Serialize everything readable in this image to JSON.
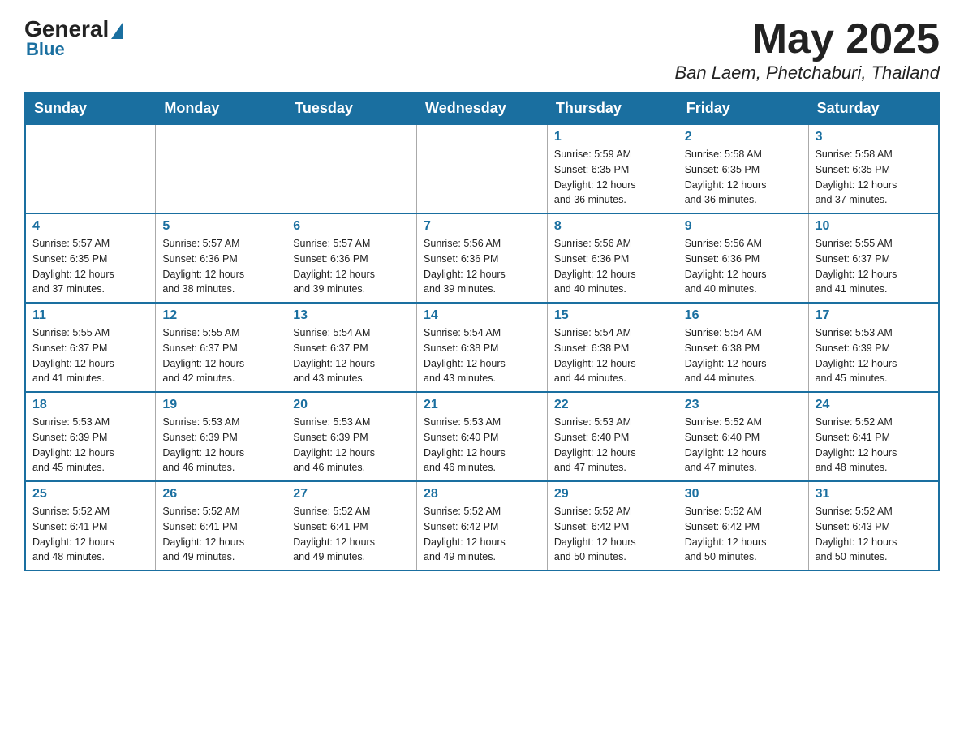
{
  "header": {
    "logo_general": "General",
    "logo_blue": "Blue",
    "month_title": "May 2025",
    "location": "Ban Laem, Phetchaburi, Thailand"
  },
  "days_of_week": [
    "Sunday",
    "Monday",
    "Tuesday",
    "Wednesday",
    "Thursday",
    "Friday",
    "Saturday"
  ],
  "weeks": [
    [
      {
        "day": "",
        "info": ""
      },
      {
        "day": "",
        "info": ""
      },
      {
        "day": "",
        "info": ""
      },
      {
        "day": "",
        "info": ""
      },
      {
        "day": "1",
        "info": "Sunrise: 5:59 AM\nSunset: 6:35 PM\nDaylight: 12 hours\nand 36 minutes."
      },
      {
        "day": "2",
        "info": "Sunrise: 5:58 AM\nSunset: 6:35 PM\nDaylight: 12 hours\nand 36 minutes."
      },
      {
        "day": "3",
        "info": "Sunrise: 5:58 AM\nSunset: 6:35 PM\nDaylight: 12 hours\nand 37 minutes."
      }
    ],
    [
      {
        "day": "4",
        "info": "Sunrise: 5:57 AM\nSunset: 6:35 PM\nDaylight: 12 hours\nand 37 minutes."
      },
      {
        "day": "5",
        "info": "Sunrise: 5:57 AM\nSunset: 6:36 PM\nDaylight: 12 hours\nand 38 minutes."
      },
      {
        "day": "6",
        "info": "Sunrise: 5:57 AM\nSunset: 6:36 PM\nDaylight: 12 hours\nand 39 minutes."
      },
      {
        "day": "7",
        "info": "Sunrise: 5:56 AM\nSunset: 6:36 PM\nDaylight: 12 hours\nand 39 minutes."
      },
      {
        "day": "8",
        "info": "Sunrise: 5:56 AM\nSunset: 6:36 PM\nDaylight: 12 hours\nand 40 minutes."
      },
      {
        "day": "9",
        "info": "Sunrise: 5:56 AM\nSunset: 6:36 PM\nDaylight: 12 hours\nand 40 minutes."
      },
      {
        "day": "10",
        "info": "Sunrise: 5:55 AM\nSunset: 6:37 PM\nDaylight: 12 hours\nand 41 minutes."
      }
    ],
    [
      {
        "day": "11",
        "info": "Sunrise: 5:55 AM\nSunset: 6:37 PM\nDaylight: 12 hours\nand 41 minutes."
      },
      {
        "day": "12",
        "info": "Sunrise: 5:55 AM\nSunset: 6:37 PM\nDaylight: 12 hours\nand 42 minutes."
      },
      {
        "day": "13",
        "info": "Sunrise: 5:54 AM\nSunset: 6:37 PM\nDaylight: 12 hours\nand 43 minutes."
      },
      {
        "day": "14",
        "info": "Sunrise: 5:54 AM\nSunset: 6:38 PM\nDaylight: 12 hours\nand 43 minutes."
      },
      {
        "day": "15",
        "info": "Sunrise: 5:54 AM\nSunset: 6:38 PM\nDaylight: 12 hours\nand 44 minutes."
      },
      {
        "day": "16",
        "info": "Sunrise: 5:54 AM\nSunset: 6:38 PM\nDaylight: 12 hours\nand 44 minutes."
      },
      {
        "day": "17",
        "info": "Sunrise: 5:53 AM\nSunset: 6:39 PM\nDaylight: 12 hours\nand 45 minutes."
      }
    ],
    [
      {
        "day": "18",
        "info": "Sunrise: 5:53 AM\nSunset: 6:39 PM\nDaylight: 12 hours\nand 45 minutes."
      },
      {
        "day": "19",
        "info": "Sunrise: 5:53 AM\nSunset: 6:39 PM\nDaylight: 12 hours\nand 46 minutes."
      },
      {
        "day": "20",
        "info": "Sunrise: 5:53 AM\nSunset: 6:39 PM\nDaylight: 12 hours\nand 46 minutes."
      },
      {
        "day": "21",
        "info": "Sunrise: 5:53 AM\nSunset: 6:40 PM\nDaylight: 12 hours\nand 46 minutes."
      },
      {
        "day": "22",
        "info": "Sunrise: 5:53 AM\nSunset: 6:40 PM\nDaylight: 12 hours\nand 47 minutes."
      },
      {
        "day": "23",
        "info": "Sunrise: 5:52 AM\nSunset: 6:40 PM\nDaylight: 12 hours\nand 47 minutes."
      },
      {
        "day": "24",
        "info": "Sunrise: 5:52 AM\nSunset: 6:41 PM\nDaylight: 12 hours\nand 48 minutes."
      }
    ],
    [
      {
        "day": "25",
        "info": "Sunrise: 5:52 AM\nSunset: 6:41 PM\nDaylight: 12 hours\nand 48 minutes."
      },
      {
        "day": "26",
        "info": "Sunrise: 5:52 AM\nSunset: 6:41 PM\nDaylight: 12 hours\nand 49 minutes."
      },
      {
        "day": "27",
        "info": "Sunrise: 5:52 AM\nSunset: 6:41 PM\nDaylight: 12 hours\nand 49 minutes."
      },
      {
        "day": "28",
        "info": "Sunrise: 5:52 AM\nSunset: 6:42 PM\nDaylight: 12 hours\nand 49 minutes."
      },
      {
        "day": "29",
        "info": "Sunrise: 5:52 AM\nSunset: 6:42 PM\nDaylight: 12 hours\nand 50 minutes."
      },
      {
        "day": "30",
        "info": "Sunrise: 5:52 AM\nSunset: 6:42 PM\nDaylight: 12 hours\nand 50 minutes."
      },
      {
        "day": "31",
        "info": "Sunrise: 5:52 AM\nSunset: 6:43 PM\nDaylight: 12 hours\nand 50 minutes."
      }
    ]
  ]
}
